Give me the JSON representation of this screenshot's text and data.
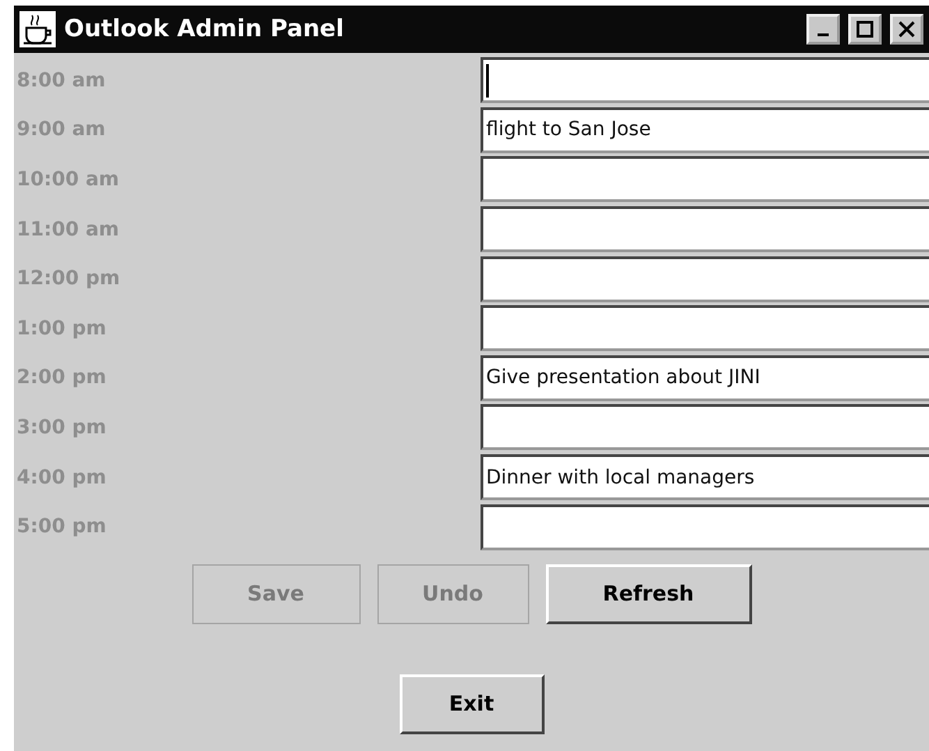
{
  "window": {
    "title": "Outlook Admin Panel"
  },
  "slots": [
    {
      "time": "8:00 am",
      "focused": true
    },
    {
      "time": "9:00 am",
      "value": "flight to San Jose",
      "focused": false
    },
    {
      "time": "10:00 am",
      "focused": false
    },
    {
      "time": "11:00 am",
      "focused": false
    },
    {
      "time": "12:00 pm",
      "focused": false
    },
    {
      "time": "1:00 pm",
      "focused": false
    },
    {
      "time": "2:00 pm",
      "value": "Give presentation about JINI",
      "focused": false
    },
    {
      "time": "3:00 pm",
      "focused": false
    },
    {
      "time": "4:00 pm",
      "value": "Dinner with local managers",
      "focused": false
    },
    {
      "time": "5:00 pm",
      "focused": false
    }
  ],
  "buttons": [
    {
      "label": "Save",
      "disabled": true
    },
    {
      "label": "Undo",
      "disabled": true
    },
    {
      "label": "Refresh",
      "disabled": false
    }
  ],
  "exit_button": {
    "label": "Exit",
    "disabled": false
  }
}
